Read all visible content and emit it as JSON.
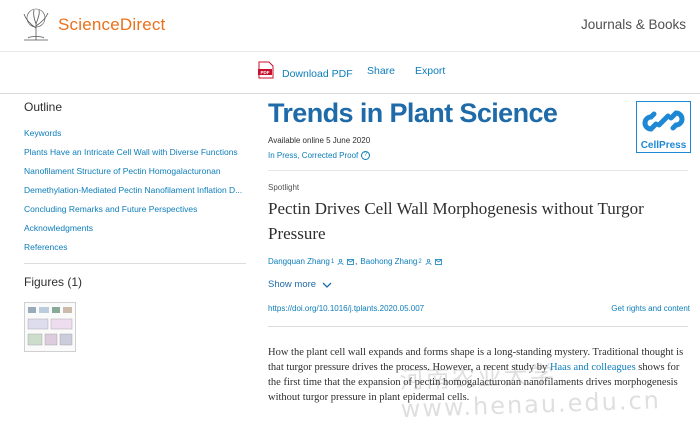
{
  "header": {
    "brand": "ScienceDirect",
    "journals_link": "Journals & Books"
  },
  "toolbar": {
    "download_pdf": "Download PDF",
    "share": "Share",
    "export": "Export"
  },
  "sidebar": {
    "outline_title": "Outline",
    "items": [
      {
        "label": "Keywords"
      },
      {
        "label": "Plants Have an Intricate Cell Wall with Diverse Functions"
      },
      {
        "label": "Nanofilament Structure of Pectin Homogalacturonan"
      },
      {
        "label": "Demethylation-Mediated Pectin Nanofilament Inflation D..."
      },
      {
        "label": "Concluding Remarks and Future Perspectives"
      },
      {
        "label": "Acknowledgments"
      },
      {
        "label": "References"
      }
    ],
    "figures_title": "Figures (1)"
  },
  "article": {
    "journal": "Trends in Plant Science",
    "publisher_logo": "CellPress",
    "available": "Available online 5 June 2020",
    "status": "In Press, Corrected Proof",
    "type_label": "Spotlight",
    "title": "Pectin Drives Cell Wall Morphogenesis without Turgor Pressure",
    "authors": [
      {
        "name": "Dangquan Zhang",
        "sup": "1"
      },
      {
        "name": "Baohong Zhang",
        "sup": "2"
      }
    ],
    "show_more": "Show more",
    "doi": "https://doi.org/10.1016/j.tplants.2020.05.007",
    "rights": "Get rights and content",
    "abstract_pre": "How the plant cell wall expands and forms shape is a long-standing mystery. Traditional thought is that turgor pressure drives the process. However, a recent study by ",
    "abstract_link": "Haas and colleagues",
    "abstract_post": " shows for the first time that the expansion of pectin homogalacturonan nanofilaments drives morphogenesis without turgor pressure in plant epidermal cells."
  },
  "watermark": "河南农业大学 www.henau.edu.cn",
  "colors": {
    "brand_orange": "#e9711c",
    "link_blue": "#0c7dbb",
    "journal_blue": "#1f6aa8"
  }
}
